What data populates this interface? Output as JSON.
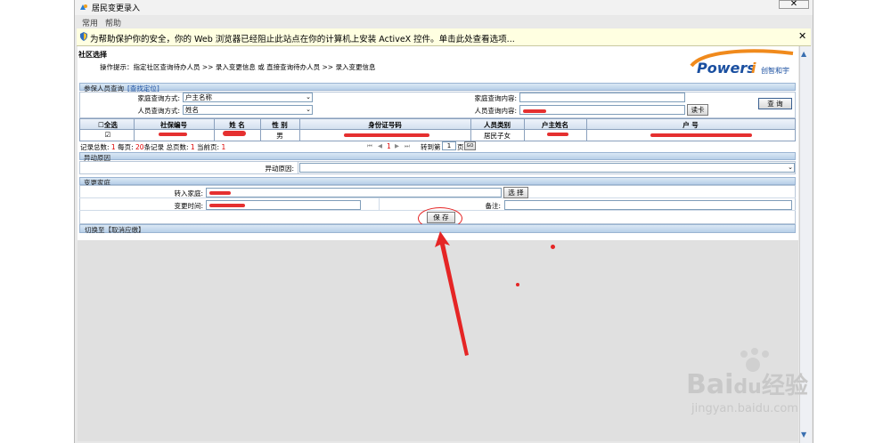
{
  "window": {
    "title": "居民变更录入",
    "close_glyph": "✕"
  },
  "menubar": {
    "items": [
      "常用",
      "帮助"
    ]
  },
  "infobar": {
    "text": "为帮助保护你的安全，你的 Web 浏览器已经阻止此站点在你的计算机上安装 ActiveX 控件。单击此处查看选项...",
    "close_glyph": "✕"
  },
  "header": {
    "title": "社区选择",
    "prompt": "操作提示：指定社区查询待办人员 >> 录入变更信息 或 直接查询待办人员 >> 录入变更信息",
    "logo_main": "Powersi",
    "logo_sub": "创智和宇"
  },
  "query": {
    "section_title": "参保人员查询",
    "section_link": "[查找定位]",
    "family_mode_label": "家庭查询方式:",
    "family_mode_value": "户主名称",
    "person_mode_label": "人员查询方式:",
    "person_mode_value": "姓名",
    "family_content_label": "家庭查询内容:",
    "family_content_value": "",
    "person_content_label": "人员查询内容:",
    "read_card_button": "读卡",
    "search_button": "查 询"
  },
  "table": {
    "headers": [
      "全选",
      "社保编号",
      "姓 名",
      "性 别",
      "身份证号码",
      "人员类别",
      "户主姓名",
      "户 号"
    ],
    "rows": [
      {
        "checked": "☑",
        "gender": "男",
        "category": "居民子女"
      }
    ]
  },
  "pagination": {
    "total_label": "记录总数:",
    "total_value": "1",
    "per_page_label": "每页:",
    "per_page_value": "20",
    "per_page_unit": "条记录",
    "pages_label": "总页数:",
    "pages_value": "1",
    "current_label": "当前页:",
    "current_value": "1",
    "nav_first": "⏮",
    "nav_prev": "◀",
    "nav_page": "1",
    "nav_next": "▶",
    "nav_last": "⏭",
    "goto_label": "转到第",
    "goto_value": "1",
    "goto_unit": "页",
    "go_button": "GO"
  },
  "reason": {
    "section_title": "异动原因",
    "label": "异动原因:",
    "value": ""
  },
  "change_family": {
    "section_title": "变更家庭",
    "to_family_label": "转入家庭:",
    "select_button": "选 择",
    "time_label": "变更时间:",
    "remark_label": "备注:",
    "remark_value": "",
    "save_button": "保 存"
  },
  "footer": {
    "text": "切换至【取消应缴】"
  },
  "watermark": {
    "brand": "Bai",
    "brand_tail": "du",
    "brand_cn": "经验",
    "url": "jingyan.baidu.com"
  },
  "colors": {
    "accent_red": "#e52525",
    "section_blue": "#b8cfe8",
    "infobar": "#ffffe1"
  }
}
